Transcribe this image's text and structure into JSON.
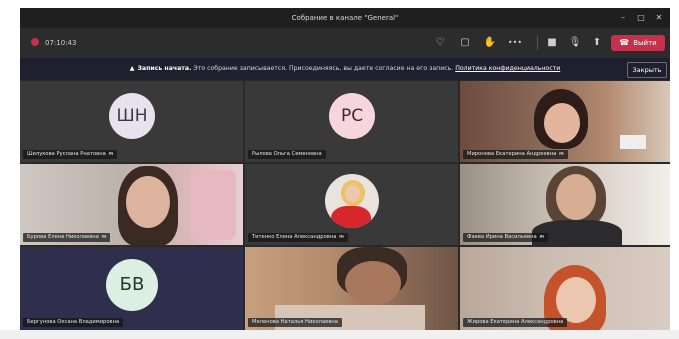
{
  "window": {
    "title": "Собрание в канале \"General\"",
    "controls": {
      "minimize": "–",
      "maximize": "□",
      "close": "✕"
    }
  },
  "toolbar": {
    "timer": "07:10:43",
    "icons": {
      "share_tray": "♡",
      "chat": "▢",
      "raise_hand": "✋",
      "more": "•••",
      "camera": "■",
      "mic": "🎙",
      "share": "⬆"
    },
    "leave_label": "Выйти"
  },
  "banner": {
    "prefix": "Запись начата.",
    "text": " Это собрание записывается. Присоединяясь, вы даете согласие на его запись. ",
    "link": "Политика конфиденциальности",
    "close_label": "Закрыть"
  },
  "participants": [
    {
      "name": "Шилукова Руслана Рнатовна",
      "initials": "ШН",
      "avatar_bg": "#e6e3ee",
      "avatar_fg": "#3a3a4a"
    },
    {
      "name": "Рылова Ольга Семеновна",
      "initials": "РС",
      "avatar_bg": "#f6d5dd",
      "avatar_fg": "#3a2a30"
    },
    {
      "name": "Миронова Екатерина Андреевна",
      "initials": "",
      "avatar_bg": "",
      "avatar_fg": ""
    },
    {
      "name": "Бурова Елена Николаевна",
      "initials": "",
      "avatar_bg": "",
      "avatar_fg": ""
    },
    {
      "name": "Титенко Елена Александровна",
      "initials": "",
      "avatar_bg": "",
      "avatar_fg": ""
    },
    {
      "name": "Фаева Ирина Васильевна",
      "initials": "",
      "avatar_bg": "",
      "avatar_fg": ""
    },
    {
      "name": "Бергунова Оксана Владимировна",
      "initials": "БВ",
      "avatar_bg": "#dcefe2",
      "avatar_fg": "#233a2a"
    },
    {
      "name": "Меленова Наталья Николаевна",
      "initials": "",
      "avatar_bg": "",
      "avatar_fg": ""
    },
    {
      "name": "Жирова Екатерина Александровна",
      "initials": "",
      "avatar_bg": "",
      "avatar_fg": ""
    }
  ],
  "colors": {
    "accent": "#c4314b",
    "app_bg": "#292929",
    "banner_bg": "#1f1f2e"
  }
}
